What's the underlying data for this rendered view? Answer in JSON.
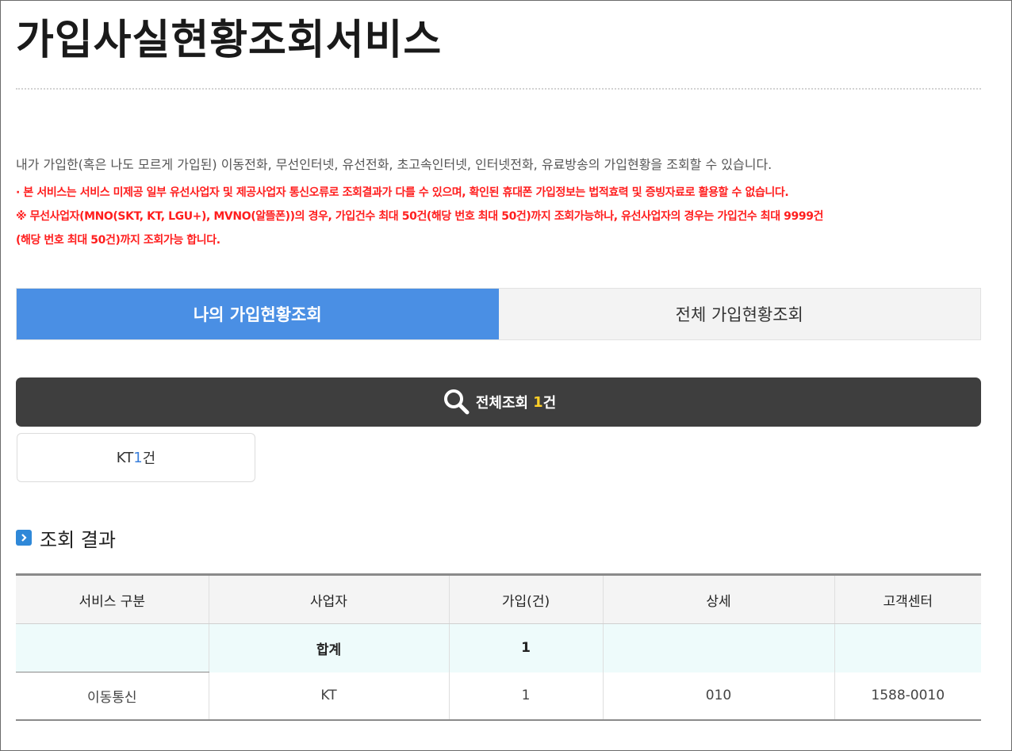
{
  "page": {
    "title": "가입사실현황조회서비스",
    "description": "내가 가입한(혹은 나도 모르게 가입된) 이동전화, 무선인터넷, 유선전화, 초고속인터넷, 인터넷전화, 유료방송의 가입현황을 조회할 수 있습니다.",
    "notice_1": "· 본 서비스는 서비스 미제공 일부 유선사업자 및 제공사업자 통신오류로 조회결과가 다를 수 있으며, 확인된 휴대폰 가입정보는 법적효력 및 증빙자료로 활용할 수 없습니다.",
    "notice_2_line1": "※ 무선사업자(MNO(SKT, KT, LGU+), MVNO(알뜰폰))의 경우, 가입건수 최대 50건(해당 번호 최대 50건)까지 조회가능하나, 유선사업자의 경우는 가입건수 최대 9999건",
    "notice_2_line2": "(해당 번호 최대 50건)까지 조회가능 합니다."
  },
  "tabs": [
    {
      "label": "나의 가입현황조회",
      "active": true
    },
    {
      "label": "전체 가입현황조회",
      "active": false
    }
  ],
  "search_bar": {
    "label": "전체조회",
    "count": "1",
    "unit": "건",
    "icon": "search-icon"
  },
  "carrier_filter": {
    "carrier": "KT",
    "count": "1",
    "unit": "건"
  },
  "result": {
    "section_title": "조회 결과",
    "headers": [
      "서비스 구분",
      "사업자",
      "가입(건)",
      "상세",
      "고객센터"
    ],
    "summary": {
      "label": "합계",
      "count": "1"
    },
    "rows": [
      {
        "service": "이동통신",
        "carrier": "KT",
        "count": "1",
        "detail": "010",
        "center": "1588-0010"
      }
    ]
  },
  "colors": {
    "tab_active": "#4a8fe4",
    "search_bar": "#3e3e3e",
    "notice_red": "#ff1e1e",
    "count_yellow": "#ffd027",
    "summary_bg": "#eefbfb"
  }
}
